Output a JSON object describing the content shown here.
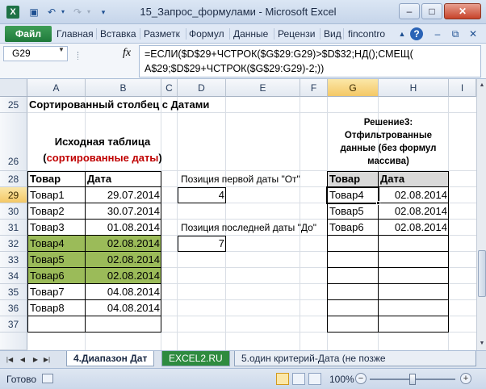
{
  "window": {
    "title": "15_Запрос_формулами - Microsoft Excel",
    "qat": {
      "logo": "X",
      "save_icon": "save-icon",
      "undo_icon": "undo-icon",
      "redo_icon": "redo-icon"
    },
    "buttons": {
      "minimize": "–",
      "maximize": "□",
      "close": "✕"
    }
  },
  "ribbon": {
    "file_tab": "Файл",
    "tabs": [
      "Главная",
      "Вставка",
      "Разметк",
      "Формул",
      "Данные",
      "Рецензи",
      "Вид",
      "fincontro"
    ],
    "icons": {
      "up": "▲",
      "help": "?",
      "min": "–",
      "restore": "⧉",
      "close": "✕"
    }
  },
  "formula_bar": {
    "name_box": "G29",
    "fx": "fx",
    "line1": "=ЕСЛИ($D$29+ЧСТРОК($G$29:G29)>$D$32;НД();СМЕЩ(",
    "line2": "A$29;$D$29+ЧСТРОК($G$29:G29)-2;))"
  },
  "columns": [
    "A",
    "B",
    "C",
    "D",
    "E",
    "F",
    "G",
    "H",
    "I"
  ],
  "rows": [
    "25",
    "26",
    "28",
    "29",
    "30",
    "31",
    "32",
    "33",
    "34",
    "35",
    "36",
    "37"
  ],
  "sheet": {
    "title": "Сортированный столбец с Датами",
    "source_label": "Исходная таблица",
    "source_sub_paren_open": "(",
    "source_sub": "сортированные даты",
    "source_sub_paren_close": ")",
    "solution_label": "Решение3:\nОтфильтрованные\nданные (без формул\nмассива)",
    "col_product": "Товар",
    "col_date": "Дата",
    "pos_first_label": "Позиция первой даты \"От\"",
    "pos_first_value": "4",
    "pos_last_label": "Позиция последней даты \"До\"",
    "pos_last_value": "7",
    "source_rows": [
      {
        "product": "Товар1",
        "date": "29.07.2014"
      },
      {
        "product": "Товар2",
        "date": "30.07.2014"
      },
      {
        "product": "Товар3",
        "date": "01.08.2014"
      },
      {
        "product": "Товар4",
        "date": "02.08.2014"
      },
      {
        "product": "Товар5",
        "date": "02.08.2014"
      },
      {
        "product": "Товар6",
        "date": "02.08.2014"
      },
      {
        "product": "Товар7",
        "date": "04.08.2014"
      },
      {
        "product": "Товар8",
        "date": "04.08.2014"
      }
    ],
    "result_rows": [
      {
        "product": "Товар4",
        "date": "02.08.2014"
      },
      {
        "product": "Товар5",
        "date": "02.08.2014"
      },
      {
        "product": "Товар6",
        "date": "02.08.2014"
      }
    ],
    "colors": {
      "highlight": "#9bbb59",
      "header_fill": "#d9d9d9",
      "red_text": "#c00000"
    }
  },
  "sheet_tabs": [
    "4.Диапазон Дат",
    "EXCEL2.RU",
    "5.один критерий-Дата (не позже"
  ],
  "status": {
    "ready": "Готово",
    "zoom": "100%",
    "minus": "−",
    "plus": "+"
  }
}
